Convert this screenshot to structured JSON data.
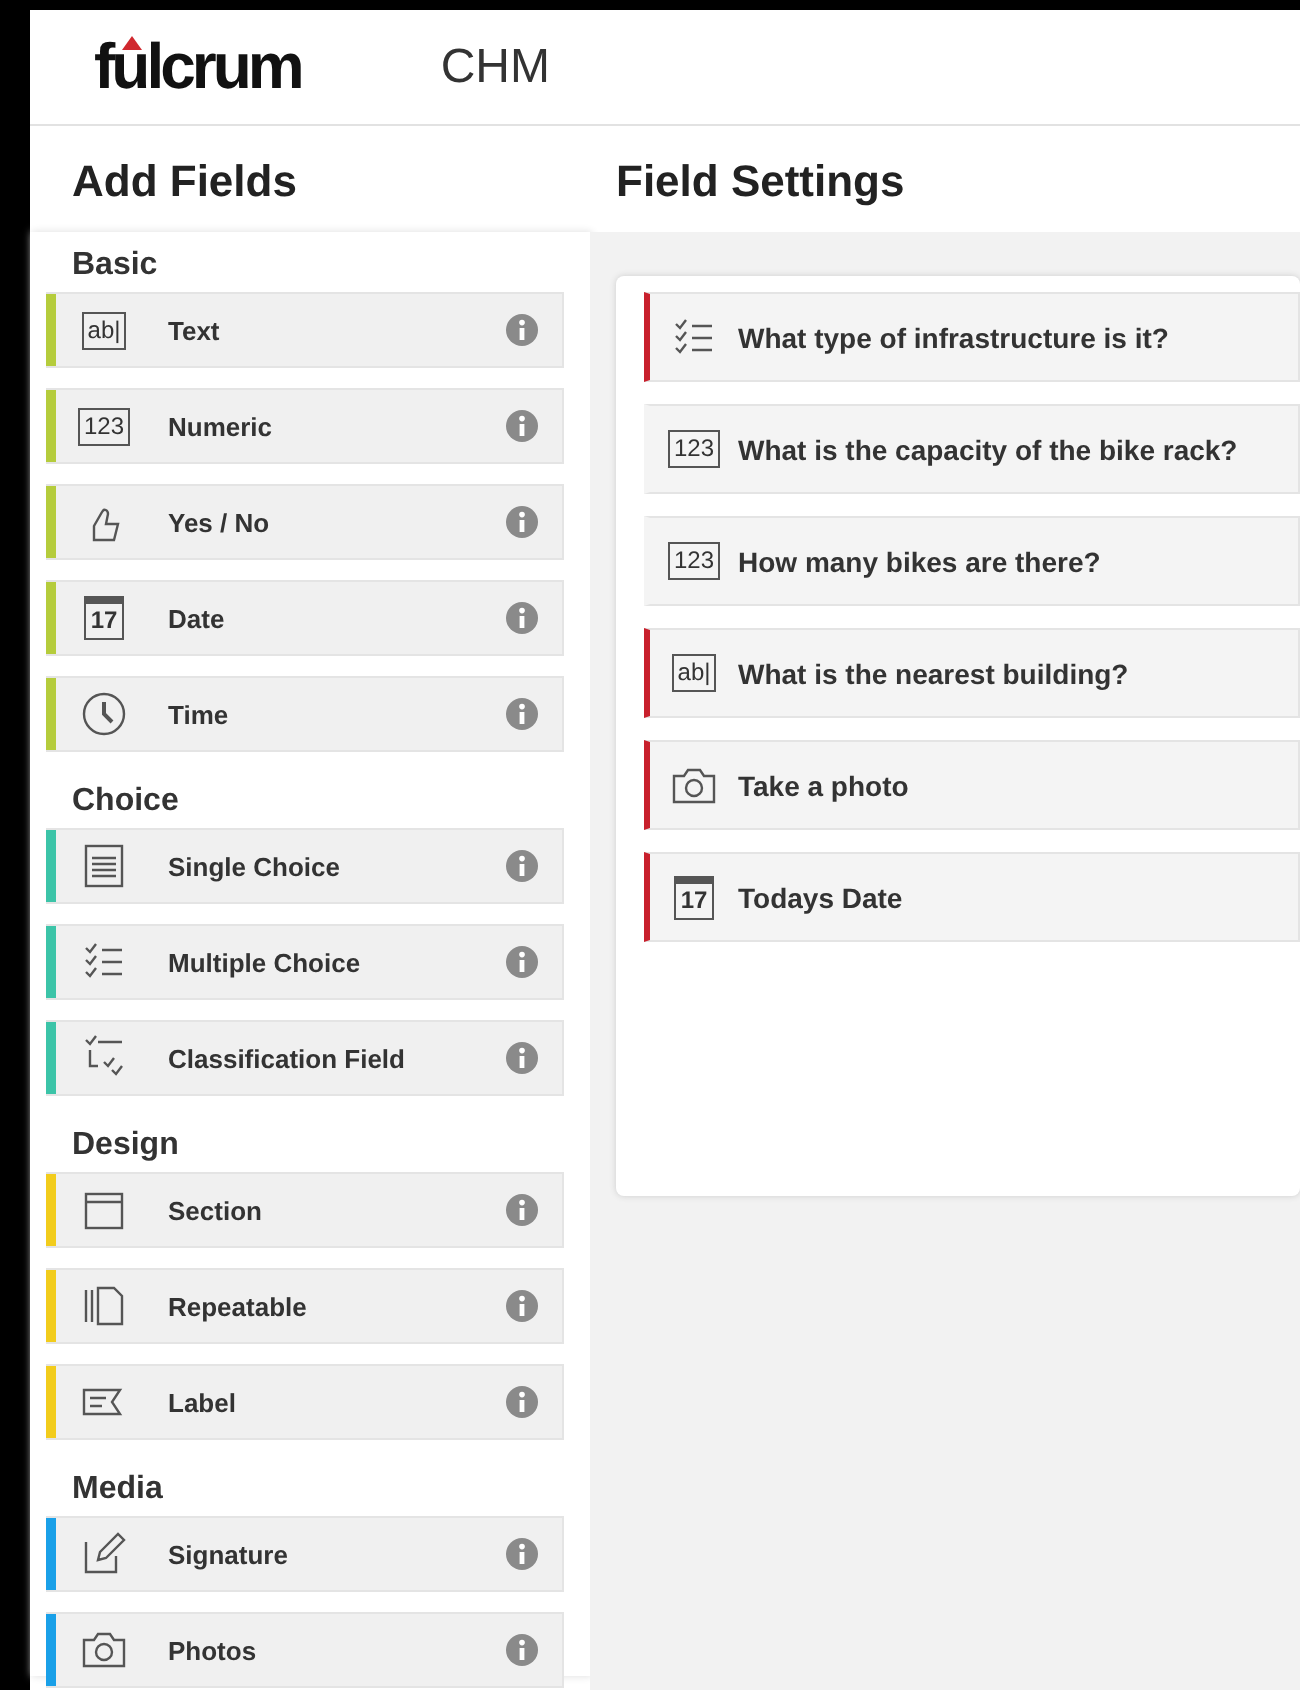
{
  "header": {
    "logo": "fulcrum",
    "app_name": "CHM"
  },
  "add_fields": {
    "title": "Add Fields",
    "groups": [
      {
        "name": "Basic",
        "color": "#b5cc3c",
        "items": [
          {
            "label": "Text",
            "kind": "text",
            "glyph": "ab|"
          },
          {
            "label": "Numeric",
            "kind": "numeric",
            "glyph": "123"
          },
          {
            "label": "Yes / No",
            "kind": "yesno"
          },
          {
            "label": "Date",
            "kind": "date",
            "glyph": "17"
          },
          {
            "label": "Time",
            "kind": "time"
          }
        ]
      },
      {
        "name": "Choice",
        "color": "#3cc4a8",
        "items": [
          {
            "label": "Single Choice",
            "kind": "single_choice"
          },
          {
            "label": "Multiple Choice",
            "kind": "multiple_choice"
          },
          {
            "label": "Classification Field",
            "kind": "classification"
          }
        ]
      },
      {
        "name": "Design",
        "color": "#f2cc1c",
        "items": [
          {
            "label": "Section",
            "kind": "section"
          },
          {
            "label": "Repeatable",
            "kind": "repeatable"
          },
          {
            "label": "Label",
            "kind": "label"
          }
        ]
      },
      {
        "name": "Media",
        "color": "#1aa0e8",
        "items": [
          {
            "label": "Signature",
            "kind": "signature"
          },
          {
            "label": "Photos",
            "kind": "photo"
          }
        ]
      }
    ]
  },
  "field_settings": {
    "title": "Field Settings",
    "fields": [
      {
        "label": "What type of infrastructure is it?",
        "kind": "multiple_choice",
        "required": true
      },
      {
        "label": "What is the capacity of the bike rack?",
        "kind": "numeric",
        "glyph": "123",
        "required": false
      },
      {
        "label": "How many bikes are there?",
        "kind": "numeric",
        "glyph": "123",
        "required": false
      },
      {
        "label": "What is the nearest building?",
        "kind": "text",
        "glyph": "ab|",
        "required": true
      },
      {
        "label": "Take a photo",
        "kind": "photo",
        "required": true
      },
      {
        "label": "Todays Date",
        "kind": "date",
        "glyph": "17",
        "required": true
      }
    ]
  }
}
